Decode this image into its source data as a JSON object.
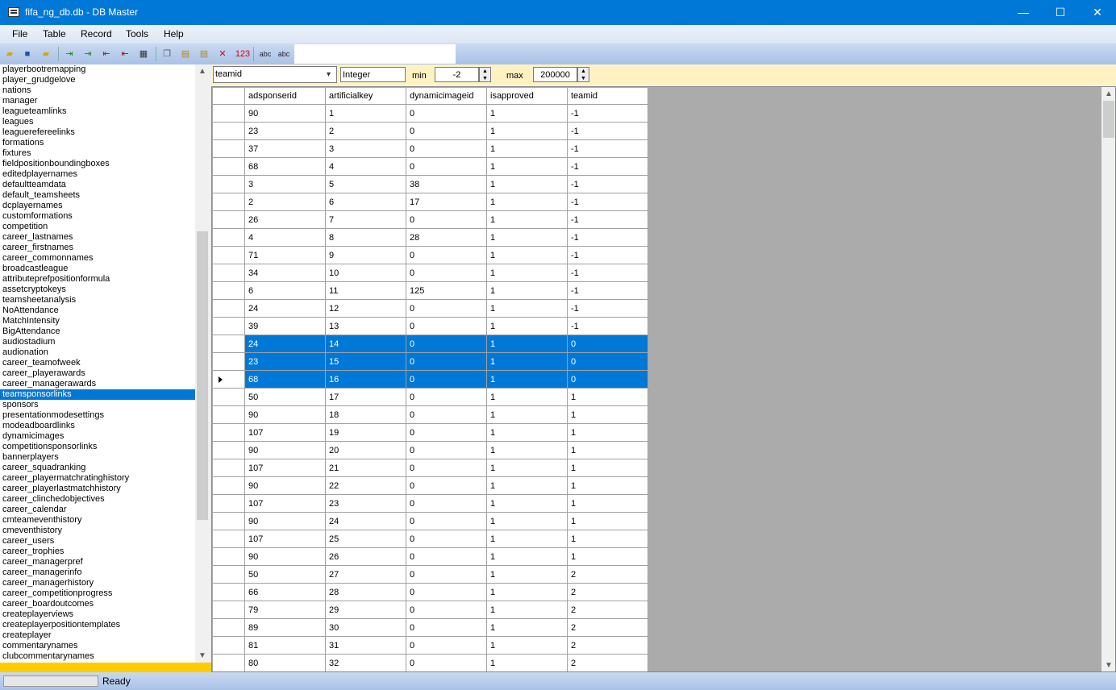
{
  "window": {
    "title": "fifa_ng_db.db - DB Master",
    "minimize": "—",
    "maximize": "☐",
    "close": "✕"
  },
  "menu": [
    "File",
    "Table",
    "Record",
    "Tools",
    "Help"
  ],
  "toolbar": {
    "numeric_icon_text": "123",
    "abc1": "abc",
    "abc2": "abc"
  },
  "tables": [
    "playerbootremapping",
    "player_grudgelove",
    "nations",
    "manager",
    "leagueteamlinks",
    "leagues",
    "leaguerefereelinks",
    "formations",
    "fixtures",
    "fieldpositionboundingboxes",
    "editedplayernames",
    "defaultteamdata",
    "default_teamsheets",
    "dcplayernames",
    "customformations",
    "competition",
    "career_lastnames",
    "career_firstnames",
    "career_commonnames",
    "broadcastleague",
    "attributeprefpositionformula",
    "assetcryptokeys",
    "teamsheetanalysis",
    "NoAttendance",
    "MatchIntensity",
    "BigAttendance",
    "audiostadium",
    "audionation",
    "career_teamofweek",
    "career_playerawards",
    "career_managerawards",
    "teamsponsorlinks",
    "sponsors",
    "presentationmodesettings",
    "modeadboardlinks",
    "dynamicimages",
    "competitionsponsorlinks",
    "bannerplayers",
    "career_squadranking",
    "career_playermatchratinghistory",
    "career_playerlastmatchhistory",
    "career_clinchedobjectives",
    "career_calendar",
    "cmteameventhistory",
    "cmeventhistory",
    "career_users",
    "career_trophies",
    "career_managerpref",
    "career_managerinfo",
    "career_managerhistory",
    "career_competitionprogress",
    "career_boardoutcomes",
    "createplayerviews",
    "createplayerpositiontemplates",
    "createplayer",
    "commentarynames",
    "clubcommentarynames"
  ],
  "selected_table": "teamsponsorlinks",
  "filter": {
    "field": "teamid",
    "type": "Integer",
    "min_label": "min",
    "min": "-2",
    "max_label": "max",
    "max": "200000"
  },
  "grid": {
    "columns": [
      "adsponserid",
      "artificialkey",
      "dynamicimageid",
      "isapproved",
      "teamid"
    ],
    "rows": [
      [
        "90",
        "1",
        "0",
        "1",
        "-1"
      ],
      [
        "23",
        "2",
        "0",
        "1",
        "-1"
      ],
      [
        "37",
        "3",
        "0",
        "1",
        "-1"
      ],
      [
        "68",
        "4",
        "0",
        "1",
        "-1"
      ],
      [
        "3",
        "5",
        "38",
        "1",
        "-1"
      ],
      [
        "2",
        "6",
        "17",
        "1",
        "-1"
      ],
      [
        "26",
        "7",
        "0",
        "1",
        "-1"
      ],
      [
        "4",
        "8",
        "28",
        "1",
        "-1"
      ],
      [
        "71",
        "9",
        "0",
        "1",
        "-1"
      ],
      [
        "34",
        "10",
        "0",
        "1",
        "-1"
      ],
      [
        "6",
        "11",
        "125",
        "1",
        "-1"
      ],
      [
        "24",
        "12",
        "0",
        "1",
        "-1"
      ],
      [
        "39",
        "13",
        "0",
        "1",
        "-1"
      ],
      [
        "24",
        "14",
        "0",
        "1",
        "0"
      ],
      [
        "23",
        "15",
        "0",
        "1",
        "0"
      ],
      [
        "68",
        "16",
        "0",
        "1",
        "0"
      ],
      [
        "50",
        "17",
        "0",
        "1",
        "1"
      ],
      [
        "90",
        "18",
        "0",
        "1",
        "1"
      ],
      [
        "107",
        "19",
        "0",
        "1",
        "1"
      ],
      [
        "90",
        "20",
        "0",
        "1",
        "1"
      ],
      [
        "107",
        "21",
        "0",
        "1",
        "1"
      ],
      [
        "90",
        "22",
        "0",
        "1",
        "1"
      ],
      [
        "107",
        "23",
        "0",
        "1",
        "1"
      ],
      [
        "90",
        "24",
        "0",
        "1",
        "1"
      ],
      [
        "107",
        "25",
        "0",
        "1",
        "1"
      ],
      [
        "90",
        "26",
        "0",
        "1",
        "1"
      ],
      [
        "50",
        "27",
        "0",
        "1",
        "2"
      ],
      [
        "66",
        "28",
        "0",
        "1",
        "2"
      ],
      [
        "79",
        "29",
        "0",
        "1",
        "2"
      ],
      [
        "89",
        "30",
        "0",
        "1",
        "2"
      ],
      [
        "81",
        "31",
        "0",
        "1",
        "2"
      ],
      [
        "80",
        "32",
        "0",
        "1",
        "2"
      ]
    ],
    "selected_rows": [
      13,
      14,
      15
    ],
    "current_row": 15
  },
  "status": {
    "text": "Ready"
  }
}
